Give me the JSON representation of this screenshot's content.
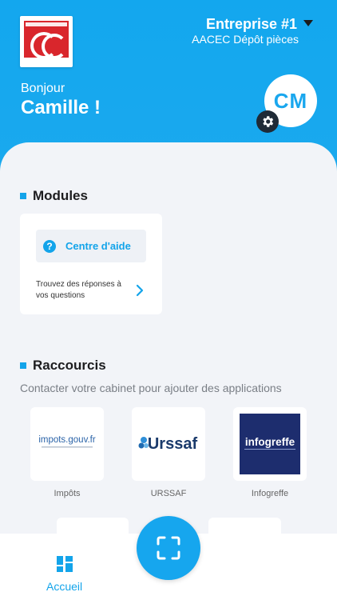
{
  "header": {
    "company": "Entreprise #1",
    "subtitle": "AACEC Dépôt pièces",
    "greeting": "Bonjour",
    "username": "Camille !",
    "avatar_initials": "CM"
  },
  "modules": {
    "title": "Modules",
    "help_card": {
      "label": "Centre d'aide",
      "description": "Trouvez des réponses à vos questions"
    }
  },
  "shortcuts": {
    "title": "Raccourcis",
    "hint": "Contacter votre cabinet pour ajouter des applications",
    "apps": [
      {
        "label": "Impôts"
      },
      {
        "label": "URSSAF"
      },
      {
        "label": "Infogreffe"
      }
    ]
  },
  "bottom_nav": {
    "home_label": "Accueil"
  },
  "colors": {
    "accent": "#13a4ea",
    "header_bg": "#1aa9ee"
  }
}
